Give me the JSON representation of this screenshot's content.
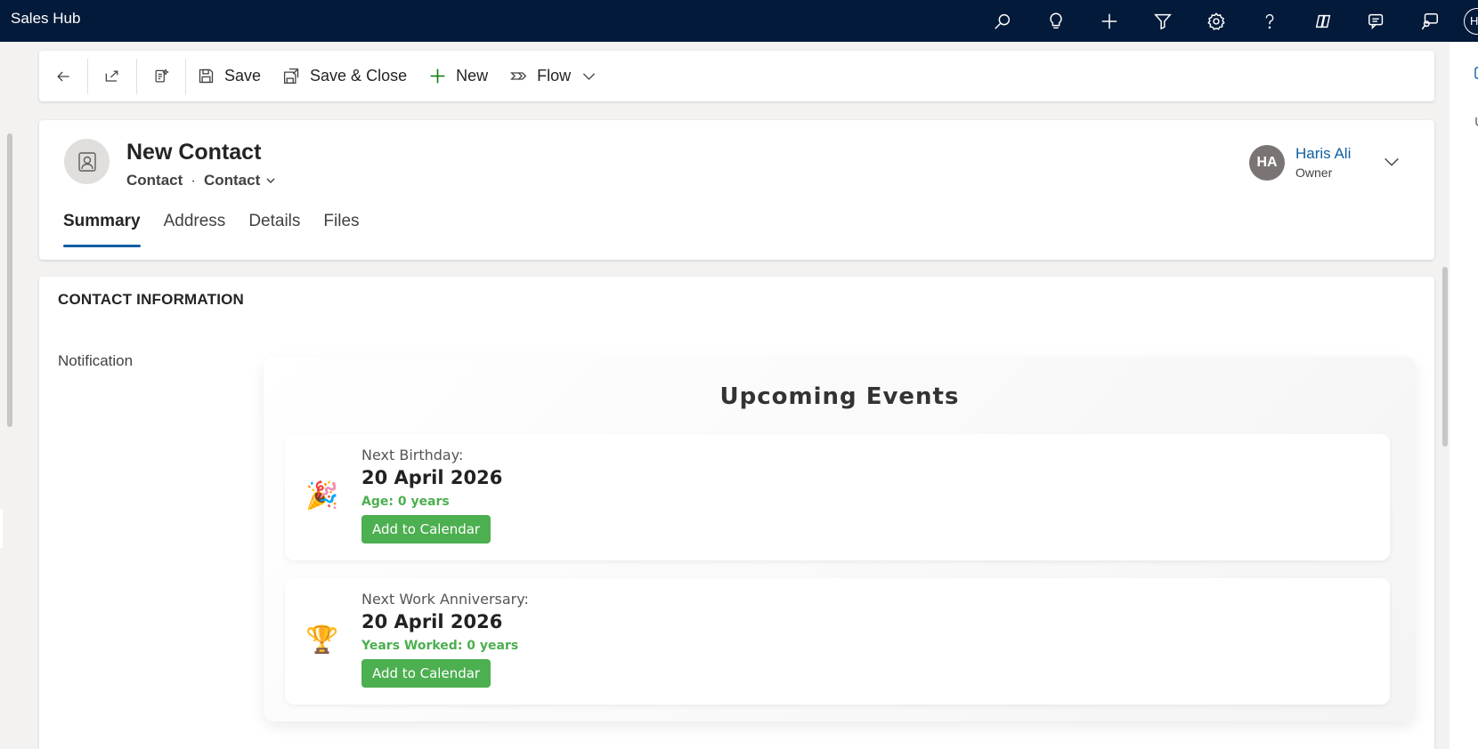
{
  "app": {
    "title": "Sales Hub",
    "user_initial": "H"
  },
  "topnav": {
    "icons": [
      "search-icon",
      "lightbulb-icon",
      "plus-icon",
      "filter-icon",
      "settings-icon",
      "help-icon",
      "copilot-icon",
      "chat-icon",
      "assistant-icon"
    ]
  },
  "commandbar": {
    "save_label": "Save",
    "save_close_label": "Save & Close",
    "new_label": "New",
    "flow_label": "Flow"
  },
  "record": {
    "title": "New Contact",
    "entity": "Contact",
    "form": "Contact",
    "owner": {
      "initials": "HA",
      "name": "Haris Ali",
      "label": "Owner"
    }
  },
  "tabs": [
    {
      "label": "Summary",
      "active": true
    },
    {
      "label": "Address",
      "active": false
    },
    {
      "label": "Details",
      "active": false
    },
    {
      "label": "Files",
      "active": false
    }
  ],
  "section": {
    "title": "CONTACT INFORMATION",
    "field_label": "Notification"
  },
  "events": {
    "title": "Upcoming Events",
    "items": [
      {
        "icon": "party-popper-icon",
        "emoji": "🎉",
        "label": "Next Birthday:",
        "date": "20 April 2026",
        "meta": "Age: 0 years",
        "button": "Add to Calendar"
      },
      {
        "icon": "trophy-icon",
        "emoji": "🏆",
        "label": "Next Work Anniversary:",
        "date": "20 April 2026",
        "meta": "Years Worked: 0 years",
        "button": "Add to Calendar"
      }
    ]
  },
  "colors": {
    "nav_bg": "#041a3a",
    "accent": "#115ea3",
    "green": "#4caf50",
    "new_icon": "#107c10"
  }
}
